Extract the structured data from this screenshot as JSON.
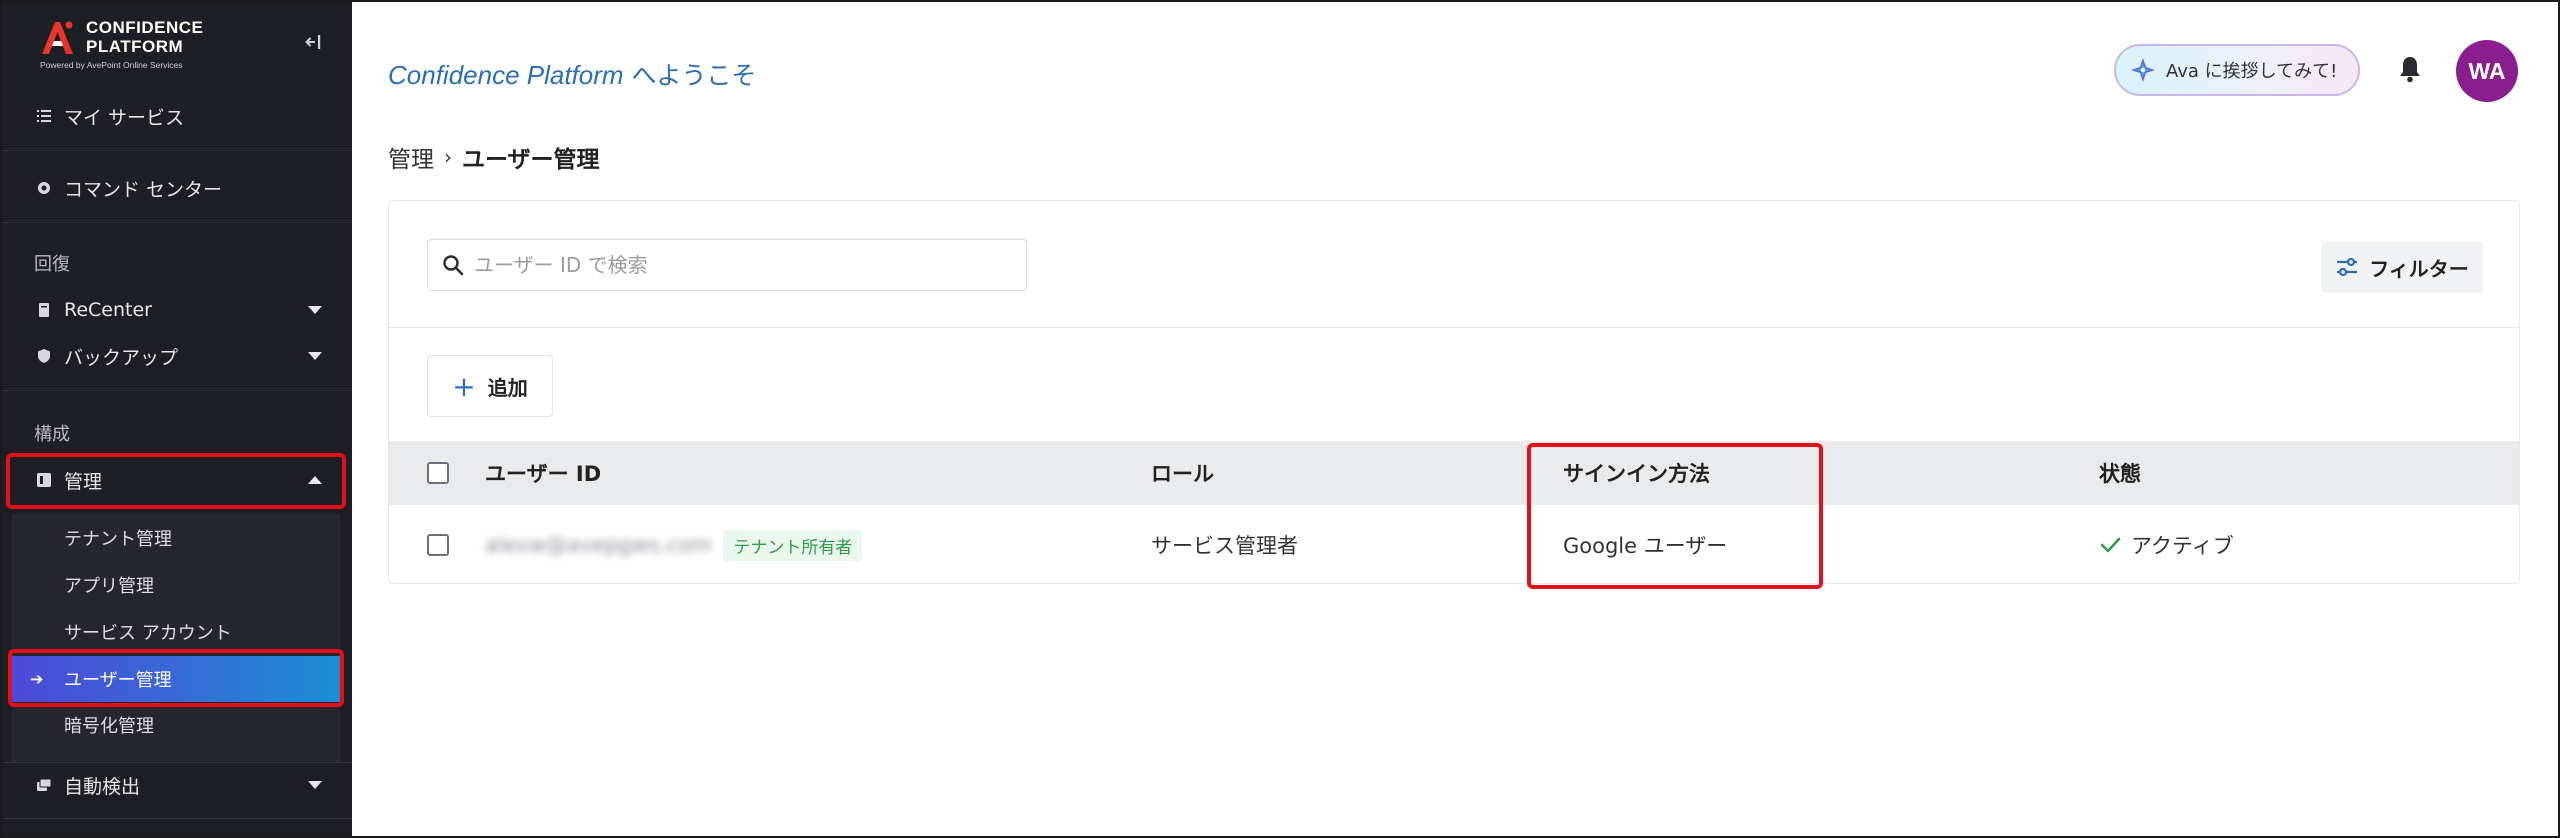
{
  "sidebar": {
    "logo": {
      "line1": "CONFIDENCE",
      "line2": "PLATFORM",
      "powered_by": "Powered by AvePoint Online Services"
    },
    "my_services": "マイ サービス",
    "command_center": "コマンド センター",
    "section_recovery": "回復",
    "recenter": "ReCenter",
    "backup": "バックアップ",
    "section_config": "構成",
    "management": "管理",
    "sub_items": [
      "テナント管理",
      "アプリ管理",
      "サービス アカウント",
      "ユーザー管理",
      "暗号化管理"
    ],
    "auto_detect": "自動検出"
  },
  "header": {
    "welcome_brand": "Confidence Platform",
    "welcome_suffix": " へようこそ",
    "ava_button": "Ava に挨拶してみて!",
    "avatar_initials": "WA"
  },
  "breadcrumb": {
    "parent": "管理",
    "separator": "›",
    "current": "ユーザー管理"
  },
  "toolbar": {
    "search_placeholder": "ユーザー ID で検索",
    "filter_label": "フィルター",
    "add_label": "追加"
  },
  "table": {
    "columns": [
      "ユーザー ID",
      "ロール",
      "サインイン方法",
      "状態"
    ],
    "rows": [
      {
        "user_id": "alexw@avepgws.com",
        "tag": "テナント所有者",
        "role": "サービス管理者",
        "signin": "Google ユーザー",
        "status": "アクティブ"
      }
    ]
  },
  "colors": {
    "sidebar_bg": "#1e1f24",
    "accent_blue": "#2a6fb3",
    "highlight_red": "#e3101a",
    "avatar_purple": "#8a1e8f",
    "active_gradient_start": "#4d4ad8",
    "active_gradient_end": "#1a8fd6",
    "status_green": "#2f9c4a"
  }
}
